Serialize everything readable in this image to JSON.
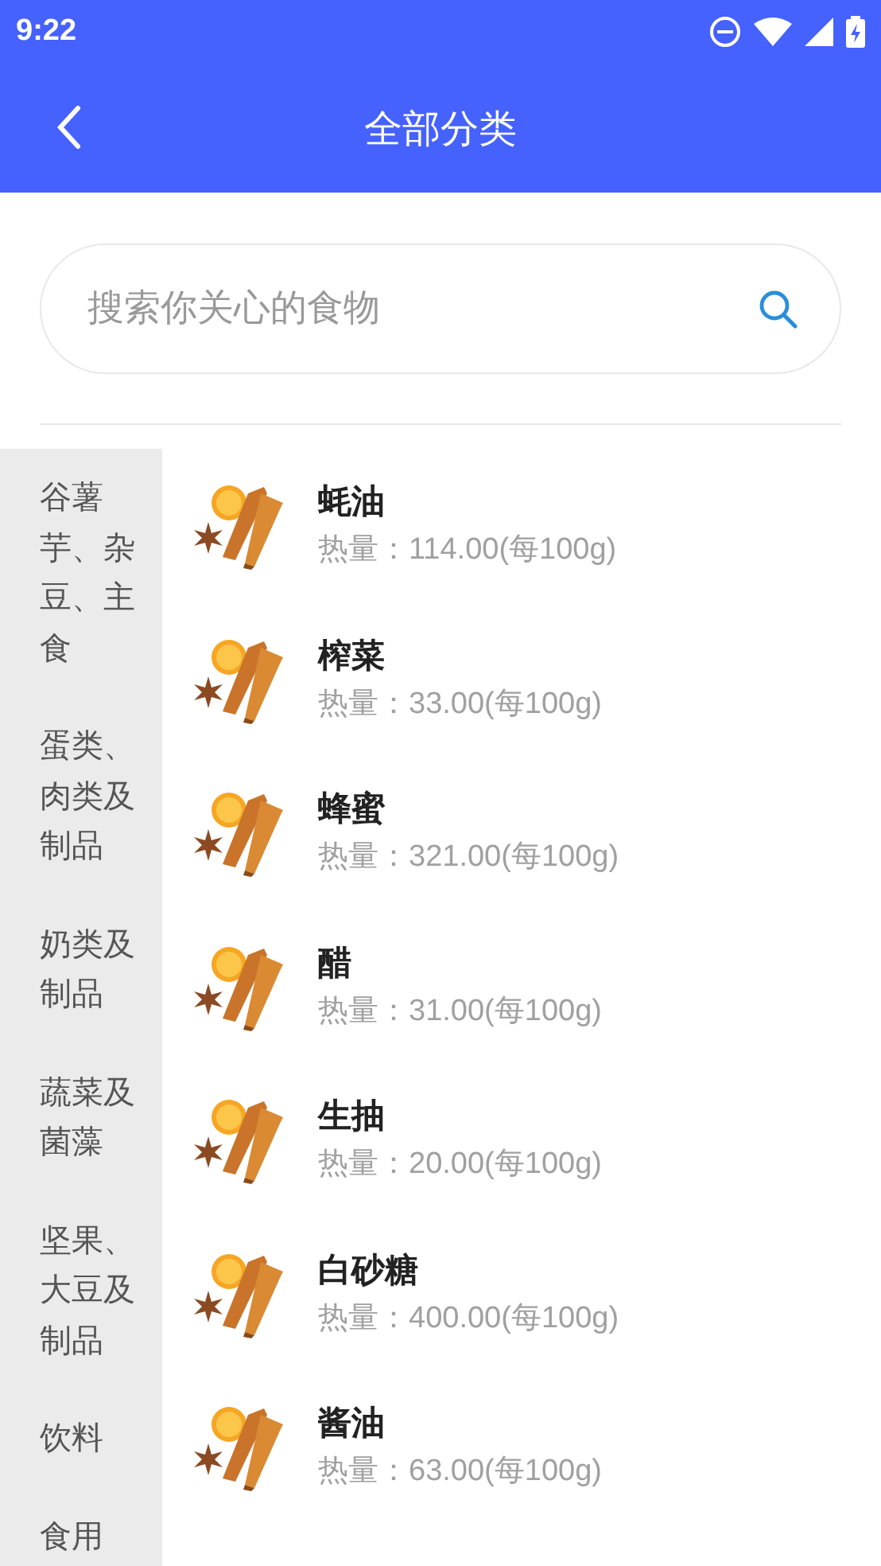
{
  "status_bar": {
    "time": "9:22"
  },
  "toolbar": {
    "title": "全部分类"
  },
  "search": {
    "placeholder": "搜索你关心的食物"
  },
  "categories": [
    {
      "label": "谷薯芋、杂豆、主食"
    },
    {
      "label": "蛋类、肉类及制品"
    },
    {
      "label": "奶类及制品"
    },
    {
      "label": "蔬菜及菌藻"
    },
    {
      "label": "坚果、大豆及制品"
    },
    {
      "label": "饮料"
    },
    {
      "label": "食用"
    }
  ],
  "foods": [
    {
      "name": "蚝油",
      "calories": "热量：114.00(每100g)"
    },
    {
      "name": "榨菜",
      "calories": "热量：33.00(每100g)"
    },
    {
      "name": "蜂蜜",
      "calories": "热量：321.00(每100g)"
    },
    {
      "name": "醋",
      "calories": "热量：31.00(每100g)"
    },
    {
      "name": "生抽",
      "calories": "热量：20.00(每100g)"
    },
    {
      "name": "白砂糖",
      "calories": "热量：400.00(每100g)"
    },
    {
      "name": "酱油",
      "calories": "热量：63.00(每100g)"
    }
  ]
}
